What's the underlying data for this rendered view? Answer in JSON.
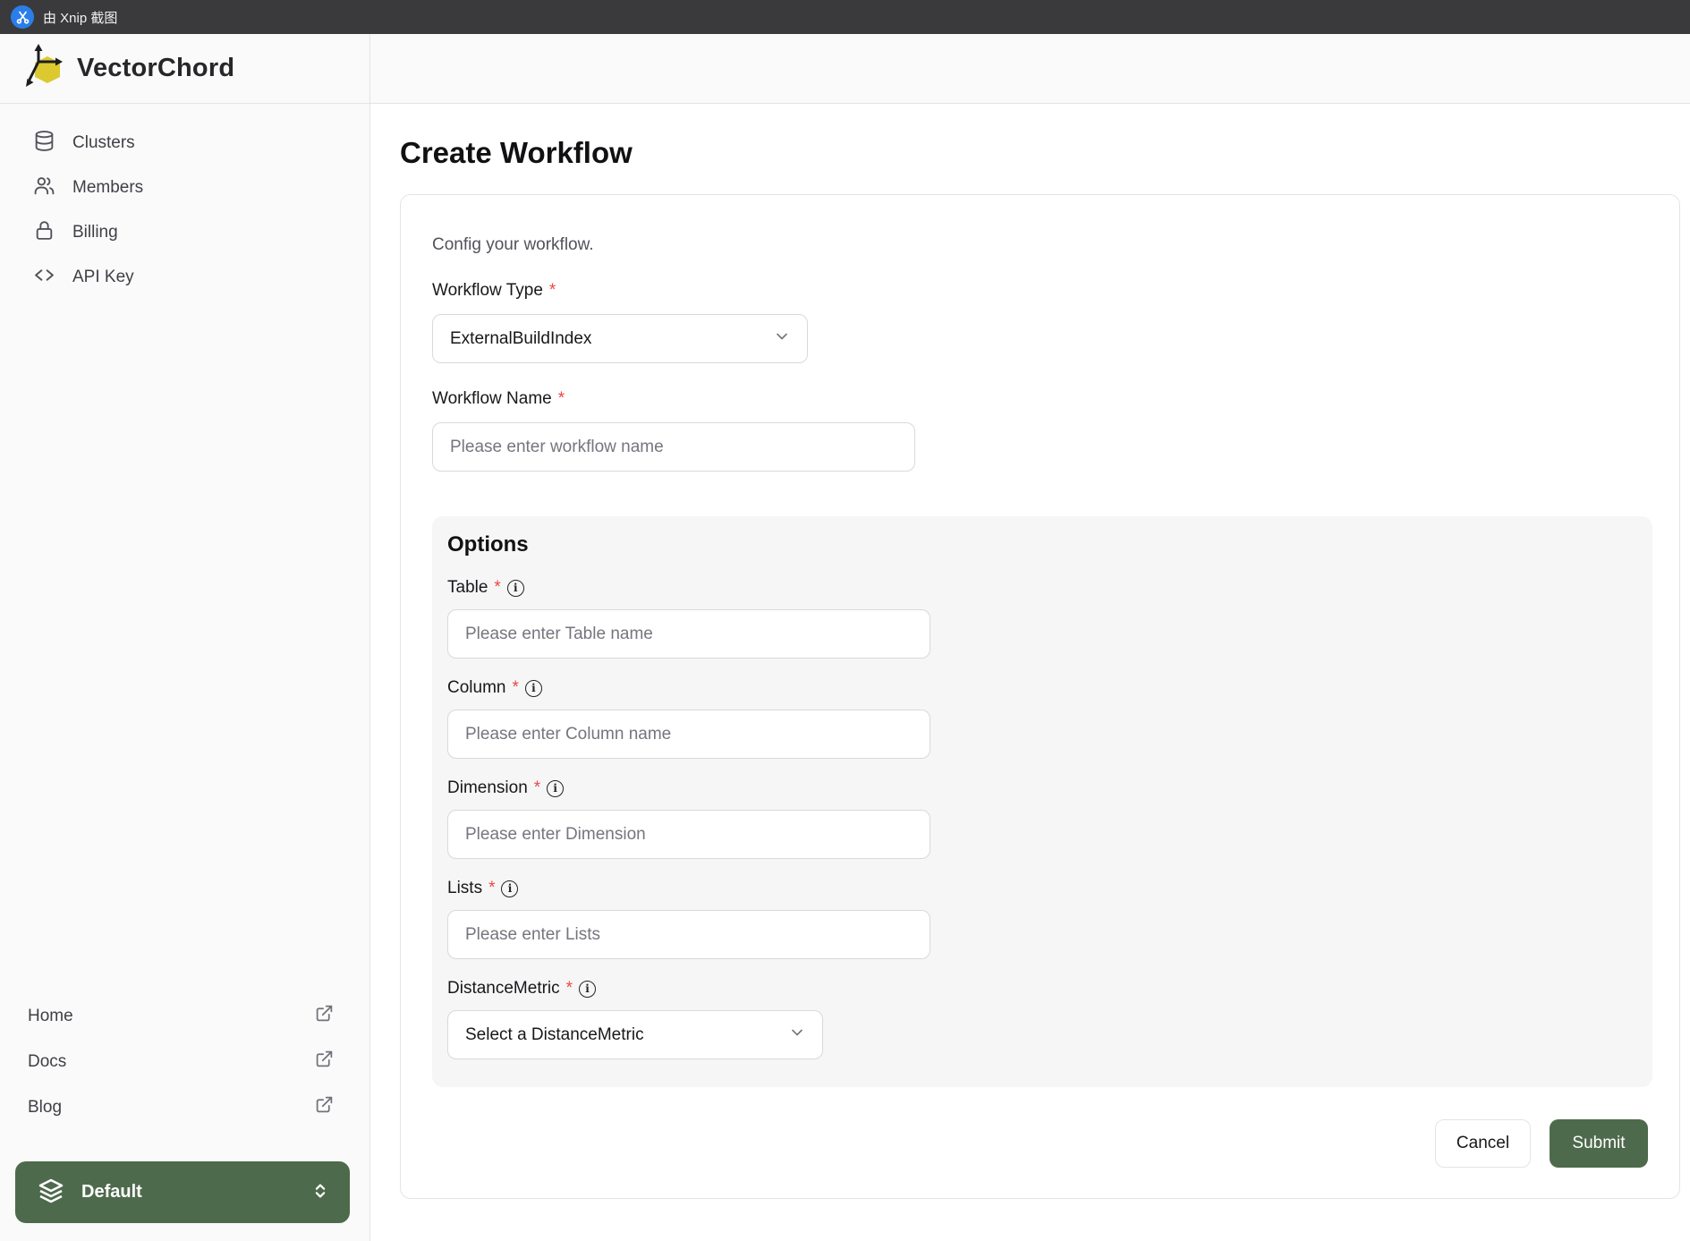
{
  "menubar": {
    "title": "由 Xnip 截图"
  },
  "brand": {
    "name": "VectorChord"
  },
  "sidebar": {
    "items": [
      {
        "label": "Clusters",
        "icon": "database-icon"
      },
      {
        "label": "Members",
        "icon": "users-icon"
      },
      {
        "label": "Billing",
        "icon": "lock-icon"
      },
      {
        "label": "API Key",
        "icon": "code-icon"
      }
    ],
    "links": [
      {
        "label": "Home",
        "icon": "external-link-icon"
      },
      {
        "label": "Docs",
        "icon": "external-link-icon"
      },
      {
        "label": "Blog",
        "icon": "external-link-icon"
      }
    ],
    "workspace": {
      "label": "Default",
      "icon": "layers-icon"
    }
  },
  "page": {
    "title": "Create Workflow"
  },
  "form": {
    "description": "Config your workflow.",
    "required_marker": "*",
    "workflow_type": {
      "label": "Workflow Type",
      "value": "ExternalBuildIndex"
    },
    "workflow_name": {
      "label": "Workflow Name",
      "placeholder": "Please enter workflow name"
    },
    "options": {
      "title": "Options",
      "fields": [
        {
          "label": "Table",
          "placeholder": "Please enter Table name",
          "control": "input"
        },
        {
          "label": "Column",
          "placeholder": "Please enter Column name",
          "control": "input"
        },
        {
          "label": "Dimension",
          "placeholder": "Please enter Dimension",
          "control": "input"
        },
        {
          "label": "Lists",
          "placeholder": "Please enter Lists",
          "control": "input"
        },
        {
          "label": "DistanceMetric",
          "placeholder": "Select a DistanceMetric",
          "control": "select"
        }
      ]
    },
    "actions": {
      "cancel": "Cancel",
      "submit": "Submit"
    }
  },
  "colors": {
    "accent_green": "#4e6a4c",
    "required_red": "#eb4747",
    "menubar_bg": "#3a3a3c",
    "xnip_blue": "#2b7de9",
    "logo_yellow": "#dcc930",
    "border": "#e4e4e7",
    "sidebar_bg": "#fafafa"
  }
}
